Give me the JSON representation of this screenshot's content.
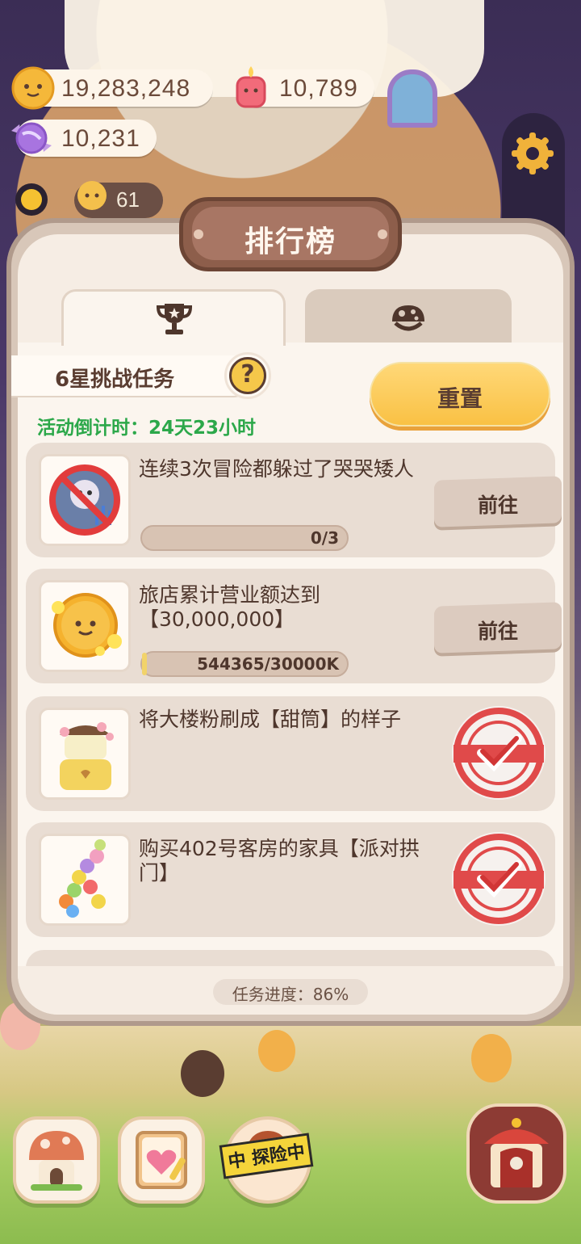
{
  "hud": {
    "coins": "19,283,248",
    "gems": "10,789",
    "candy": "10,231",
    "level": "61"
  },
  "panel": {
    "title": "排行榜",
    "tabs": [
      {
        "icon": "trophy-icon",
        "active": true
      },
      {
        "icon": "mushroom-icon",
        "active": false
      }
    ],
    "challenge_label": "6星挑战任务",
    "help_symbol": "?",
    "countdown": "活动倒计时：24天23小时",
    "reset_label": "重置",
    "tasks": [
      {
        "text": "连续3次冒险都躲过了哭哭矮人",
        "progress_text": "0/3",
        "progress": 0.0,
        "button": "前往",
        "completed": false
      },
      {
        "text": "旅店累计营业额达到【30,000,000】",
        "progress_text": "544365/30000K",
        "progress": 0.018,
        "button": "前往",
        "completed": false
      },
      {
        "text": "将大楼粉刷成【甜筒】的样子",
        "completed": true
      },
      {
        "text": "购买402号客房的家具【派对拱门】",
        "completed": true
      }
    ],
    "overall_progress": "任务进度：86%"
  },
  "bottom_nav": {
    "adventure_tape": "中 探险中"
  },
  "colors": {
    "accent_green": "#2ca84a",
    "button_yellow": "#f9c144",
    "stamp_red": "#e04a4a"
  }
}
